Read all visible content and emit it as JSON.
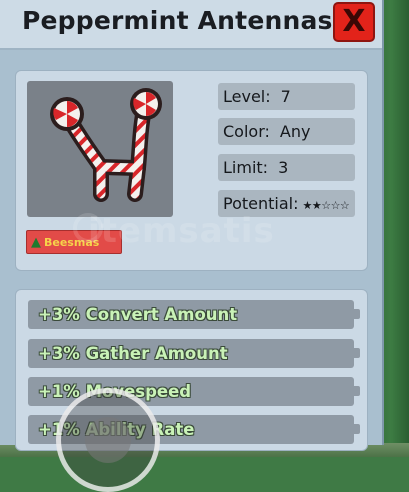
{
  "title": "Peppermint Antennas",
  "close_button": {
    "label": "X"
  },
  "item_image": {
    "icon": "peppermint-antennas-icon"
  },
  "stats": [
    {
      "label": "Level:",
      "value": "7"
    },
    {
      "label": "Color:",
      "value": "Any"
    },
    {
      "label": "Limit:",
      "value": "3"
    },
    {
      "label": "Potential:",
      "value": "★★☆☆☆"
    }
  ],
  "badge": {
    "label": "Beesmas",
    "icon": "christmas-tree-icon"
  },
  "watermark": "itemsatis",
  "abilities": [
    "+3% Convert Amount",
    "+3% Gather Amount",
    "+1% Movespeed",
    "+1% Ability Rate"
  ],
  "colors": {
    "close_button": "#e2231a",
    "ability_text": "#c9f2b7",
    "badge_bg": "#e24b48",
    "badge_text": "#f6d34a"
  }
}
